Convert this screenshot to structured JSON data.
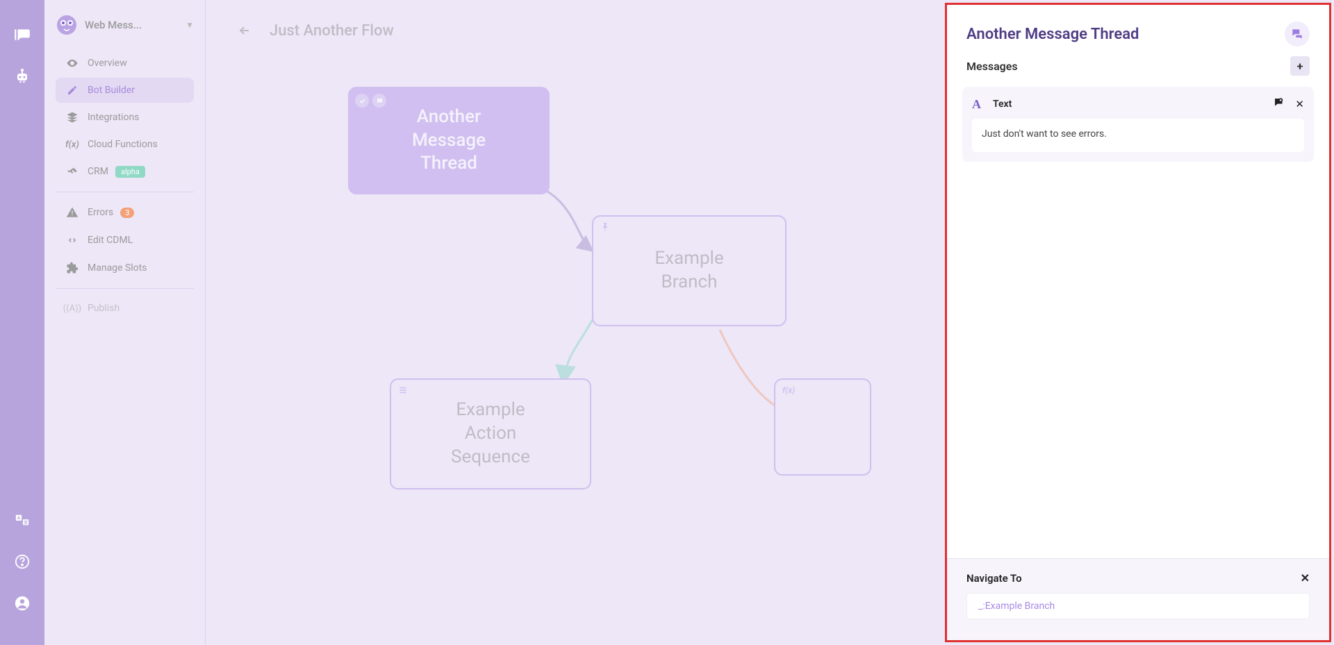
{
  "rail": {
    "icons": [
      "chat",
      "bot",
      "translate",
      "help",
      "user"
    ]
  },
  "sidebar": {
    "workspace": "Web Mess...",
    "items": [
      {
        "label": "Overview"
      },
      {
        "label": "Bot Builder"
      },
      {
        "label": "Integrations"
      },
      {
        "label": "Cloud Functions"
      },
      {
        "label": "CRM",
        "badge_alpha": "alpha"
      }
    ],
    "tools": [
      {
        "label": "Errors",
        "count": "3"
      },
      {
        "label": "Edit CDML"
      },
      {
        "label": "Manage Slots"
      }
    ],
    "publish": "Publish"
  },
  "header": {
    "flow_title": "Just Another Flow"
  },
  "nodes": {
    "thread": "Another\nMessage\nThread",
    "branch": "Example\nBranch",
    "sequence": "Example\nAction\nSequence"
  },
  "panel": {
    "title": "Another Message Thread",
    "sub": "Messages",
    "msg_type": "Text",
    "msg_body": "Just don't want to see errors.",
    "nav_label": "Navigate To",
    "nav_value": "_:Example Branch"
  }
}
